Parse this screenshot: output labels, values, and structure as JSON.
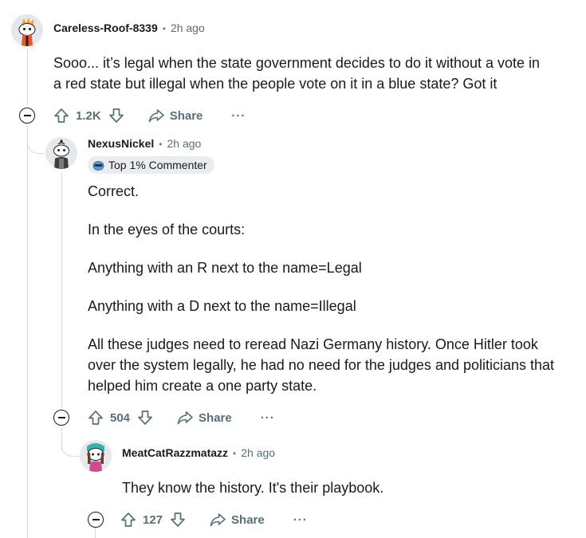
{
  "comments": [
    {
      "author": "Careless-Roof-8339",
      "time": "2h ago",
      "lines": [
        "Sooo... it’s legal when the state government decides to do it without a vote in",
        "a red state but illegal when the people vote on it in a blue state? Got it"
      ],
      "score": "1.2K",
      "share_label": "Share",
      "more_label": "···"
    },
    {
      "author": "NexusNickel",
      "time": "2h ago",
      "flair": "Top 1% Commenter",
      "paragraphs": [
        [
          "Correct."
        ],
        [
          "In the eyes of the courts:"
        ],
        [
          "Anything with an R next to the name=Legal"
        ],
        [
          "Anything with a D next to the name=Illegal"
        ],
        [
          "All these judges need to reread Nazi Germany history. Once Hitler took",
          "over the system legally, he had no need for the judges and politicians that",
          "helped him create a one party state."
        ]
      ],
      "score": "504",
      "share_label": "Share",
      "more_label": "···"
    },
    {
      "author": "MeatCatRazzmatazz",
      "time": "2h ago",
      "lines": [
        "They know the history. It's their playbook."
      ],
      "score": "127",
      "share_label": "Share",
      "more_label": "···"
    }
  ],
  "separator": "•",
  "colors": {
    "text": "#1a1a1b",
    "muted": "#576f76",
    "thread_line": "#d6dadc",
    "flair_bg": "#eaedef"
  }
}
